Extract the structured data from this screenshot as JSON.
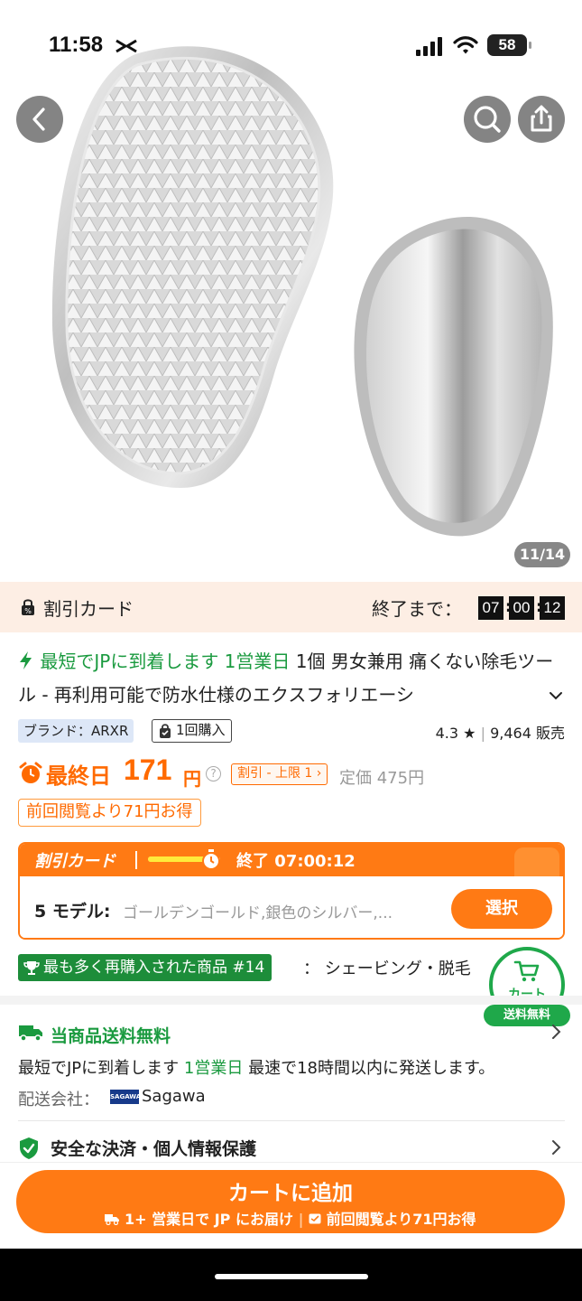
{
  "status_bar": {
    "time": "11:58",
    "battery": "58"
  },
  "gallery": {
    "counter": "11/14"
  },
  "discount_bar": {
    "label": "割引カード",
    "end_label": "終了まで：",
    "hours": "07",
    "minutes": "00",
    "seconds": "12"
  },
  "product": {
    "delivery_prefix": "最短でJPに到着します 1営業日",
    "title": "1個 男女兼用 痛くない除毛ツール - 再利用可能で防水仕様のエクスフォリエーシ",
    "brand_tag": "ブランド：ARXR",
    "purchase_tag": "1回購入",
    "rating": "4.3",
    "sold": "9,464 販売"
  },
  "price": {
    "final_label": "最終日",
    "amount": "171",
    "currency": "円",
    "info": "?",
    "limit_tag": "割引 - 上限 1",
    "limit_chevron": "›",
    "regular": "定価 475円",
    "saving": "前回閲覧より71円お得"
  },
  "discount_card": {
    "label": "割引カード",
    "end_time": "終了  07:00:12",
    "models_label": "5 モデル:",
    "models_options": "ゴールデンゴールド,銀色のシルバー,...",
    "select_button": "選択",
    "progress": 0.8
  },
  "ranking": {
    "tag": "最も多く再購入された商品 #14",
    "category": "：  シェービング・脱毛"
  },
  "cart_float": {
    "label": "カート",
    "badge": "送料無料"
  },
  "shipping": {
    "title": "当商品送料無料",
    "line_prefix": "最短でJPに到着します",
    "line_days": "1営業日",
    "line_suffix": "最速で18時間以内に発送します。",
    "carrier_label": "配送会社：",
    "carrier_logo": "SAGAWA",
    "carrier_name": "Sagawa"
  },
  "security": {
    "title": "安全な決済・個人情報保護"
  },
  "add_to_cart": {
    "label": "カートに追加",
    "sub_left": "1+ 営業日で JP にお届け",
    "sub_sep": "|",
    "sub_right": "前回閲覧より71円お得"
  },
  "colors": {
    "accent": "#ff7a14",
    "green": "#1a9a3f",
    "discount_bg": "#fdeee4"
  }
}
